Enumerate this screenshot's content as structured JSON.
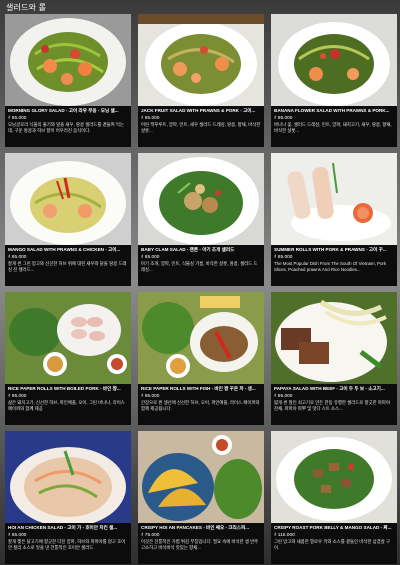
{
  "header": {
    "title": "샐러드와 롤"
  },
  "items": [
    {
      "name": "MORNING GLORY SALAD - 고이 라우 무옹 - 모닝 샐...",
      "price": "₫ 85.000",
      "desc": "모닝글로리 식물의 줄기와 잎을 새우, 땅콩 샐러드를 곁들여 먹는데, 구운 땅콩과 허브 향이 어우러진 음식이다."
    },
    {
      "name": "JACK FRUIT SALAD WITH PRAWNS & PORK - 고이...",
      "price": "₫ 85.000",
      "desc": "어린 잭푸루트, 양파, 민트, 새우 샐러드 드레싱, 땅콩, 향채, 바삭한 샬롯..."
    },
    {
      "name": "BANANA FLOWER SALAD WITH PRAWNS & PORK...",
      "price": "₫ 85.000",
      "desc": "바나나 꽃, 샐러드 드레싱, 민트, 양파, 돼지고기, 새우, 땅콩, 향채, 바삭한 샬롯..."
    },
    {
      "name": "MANGO SALAD WITH PRAWNS & CHICKEN - 고이...",
      "price": "₫ 85.000",
      "desc": "잘게 썬 그린 망고와 신선한 허브 위에 대된 새우와 닭을 땅콩 드레싱 진 샐러드..."
    },
    {
      "name": "BABY CLAM SALAD - 팬론 - 아기 조개 샐러드",
      "price": "₫ 85.000",
      "desc": "아기 조개, 양파, 민트, 식물성 기름, 바삭한 샬롯, 땅콩, 샐러드 드레싱..."
    },
    {
      "name": "SUMMER ROLLS WITH PORK & PRAWNS - 고이 꾸...",
      "price": "₫ 85.000",
      "desc": "The Most Popular Dish From The South Of Vietnam, Pork Slices, Poached prawns And Rice Noodles..."
    },
    {
      "name": "RICE PAPER ROLLS WITH BOILED PORK - 바인 짱...",
      "price": "₫ 95.000",
      "desc": "삶은 돼지고기, 신선한 허브, 파인애플, 오이, 그린 바나나, 라이스 페이퍼와 함께 제공"
    },
    {
      "name": "RICE PAPER ROLLS WITH FISH - 바인 짱 꾸온 까 - 생...",
      "price": "₫ 95.000",
      "desc": "간장으로 찐 생선에 신선한 허브, 오이, 파인애플, 라이스 페이퍼와 함께 제공됩니다."
    },
    {
      "name": "PAPAYA SALAD WITH BEEF - 고이 두 두 보 - 소고기...",
      "price": "₫ 95.000",
      "desc": "얇게 썬 절인 쇠고기로 만든 한동 유행한 샐러드로 향긋한 파파야 잔채, 파파야 파뿌 및 맛다 스트 소스..."
    },
    {
      "name": "HOI AN CHICKEN SALAD - 고이 가 - 호이안 치킨 샐...",
      "price": "₫ 85.000",
      "desc": "잘게 찢은 닭고기에 향긋한 다진 양파, 허브와 파파야를 얹고 호이안 칠리 소스로 맛을 낸 전통적인 호이안 샐러드"
    },
    {
      "name": "CRISPY HOI AN PANCAKES - 바인 쌔오 - 크리스피...",
      "price": "₫ 75.000",
      "desc": "이것은 전통적인 가볍 튀김 부침입니다. 필요 속에 바삭한 생 반주 고소하고 바삭바삭 맛있는 향채..."
    },
    {
      "name": "CRISPY ROAST PORK BELLY & MANGO SALAD - 짜...",
      "price": "₫ 115.000",
      "desc": "그린 망고와 새콤한 열로우 키와 소스를 곁들인 바삭한 삼겹살 구이."
    }
  ]
}
